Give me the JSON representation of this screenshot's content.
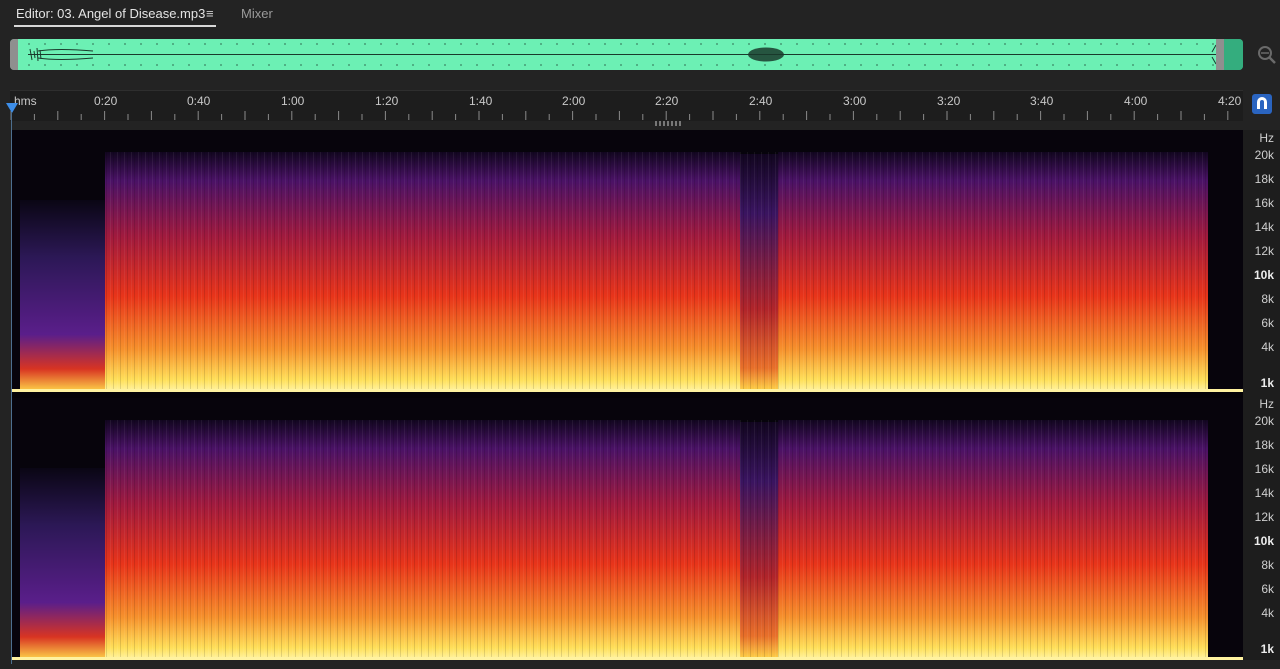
{
  "tabs": {
    "editor_label": "Editor: 03. Angel of Disease.mp3",
    "menu_glyph": "≡",
    "mixer_label": "Mixer"
  },
  "ruler": {
    "labels": [
      "hms",
      "0:20",
      "0:40",
      "1:00",
      "1:20",
      "1:40",
      "2:00",
      "2:20",
      "2:40",
      "3:00",
      "3:20",
      "3:40",
      "4:00",
      "4:20"
    ]
  },
  "frequency_axis": {
    "unit_label": "Hz",
    "labels": [
      "20k",
      "18k",
      "16k",
      "14k",
      "12k",
      "10k",
      "8k",
      "6k",
      "4k",
      "1k"
    ],
    "emphasized": [
      "10k",
      "1k"
    ]
  },
  "icons": {
    "zoom": "zoom-magnifier-icon",
    "snap": "snap-magnet-icon",
    "playhead": "playhead-marker-icon"
  },
  "colors": {
    "waveform_overview": "#6cf0b4",
    "spectral_hot": "#ffd84a",
    "spectral_mid": "#e83a18",
    "spectral_cool": "#7a1f8f",
    "playhead": "#3d8ee8"
  }
}
